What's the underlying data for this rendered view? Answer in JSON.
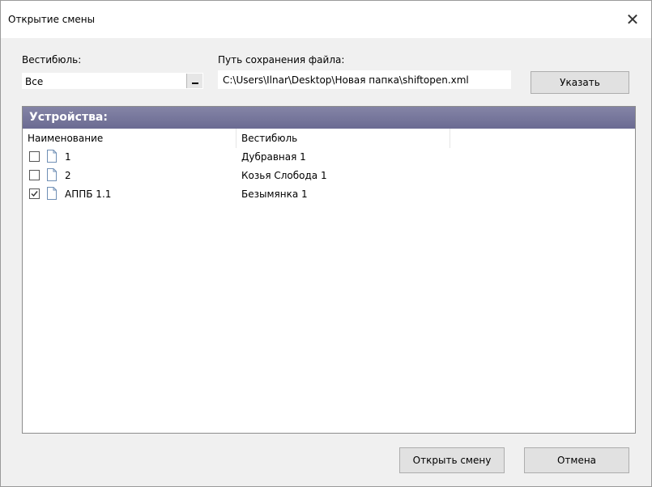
{
  "window": {
    "title": "Открытие смены"
  },
  "vestibule": {
    "label": "Вестибюль:",
    "value": "Все"
  },
  "path": {
    "label": "Путь сохранения файла:",
    "value": "C:\\Users\\Ilnar\\Desktop\\Новая папка\\shiftopen.xml"
  },
  "browse_button": "Указать",
  "devices": {
    "header": "Устройства:",
    "columns": [
      "Наименование",
      "Вестибюль",
      ""
    ],
    "rows": [
      {
        "name": "1",
        "vestibule": "Дубравная 1",
        "checked": false
      },
      {
        "name": "2",
        "vestibule": "Козья Слобода 1",
        "checked": false
      },
      {
        "name": "АППБ 1.1",
        "vestibule": "Безымянка 1",
        "checked": true
      }
    ]
  },
  "footer": {
    "open_label": "Открыть смену",
    "cancel_label": "Отмена"
  }
}
